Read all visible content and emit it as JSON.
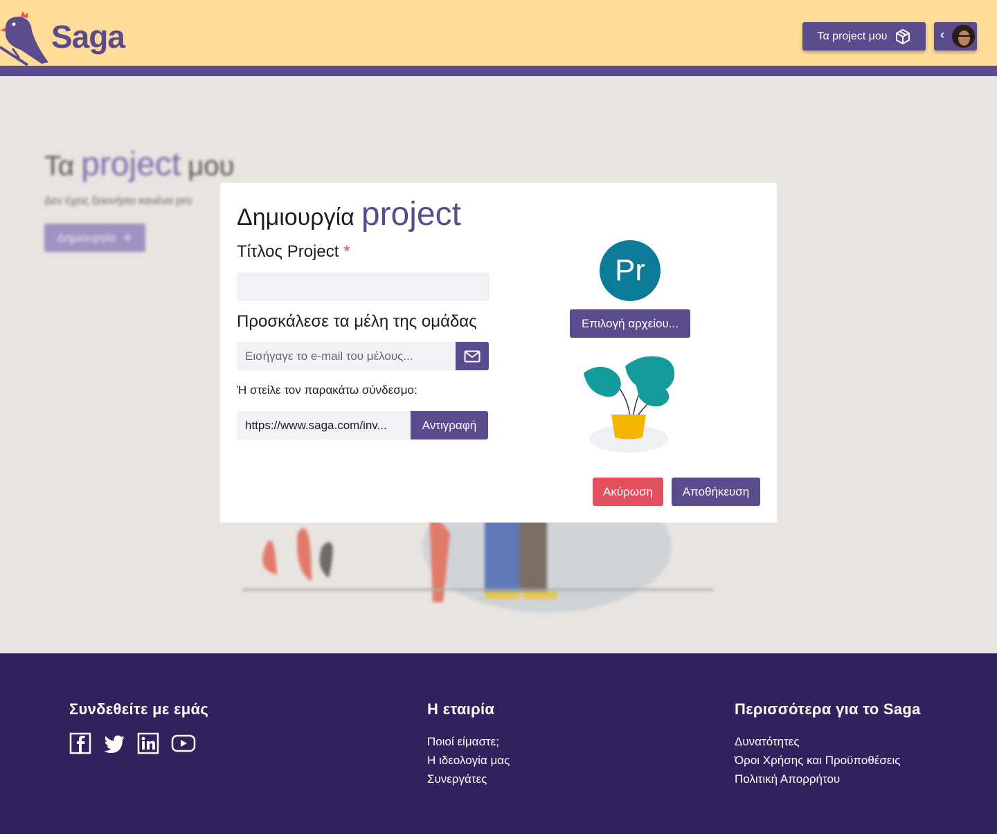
{
  "header": {
    "logo_text": "Saga",
    "projects_button": "Τα project μου"
  },
  "background": {
    "title_prefix": "Τα",
    "title_accent": "project",
    "title_suffix": "μου",
    "subtitle": "Δεν έχεις ξεκινήσει κανένα pro",
    "create_button": "Δημιουργία"
  },
  "dialog": {
    "title_prefix": "Δημιουργία",
    "title_accent": "project",
    "project_title_label": "Τίτλος Project",
    "required_mark": "*",
    "project_title_value": "",
    "invite_label": "Προσκάλεσε τα μέλη της ομάδας",
    "email_placeholder": "Εισήγαγε το e-mail του μέλους...",
    "link_label": "Ή στείλε τον παρακάτω σύνδεσμο:",
    "link_value": "https://www.saga.com/inv...",
    "copy_button": "Αντιγραφή",
    "avatar_initials": "Pr",
    "avatar_color": "#0b7b98",
    "file_button": "Επιλογή αρχείου...",
    "cancel_button": "Ακύρωση",
    "save_button": "Αποθήκευση"
  },
  "footer": {
    "connect": {
      "heading": "Συνδεθείτε με εμάς",
      "icons": [
        "facebook-icon",
        "twitter-icon",
        "linkedin-icon",
        "youtube-icon"
      ]
    },
    "company": {
      "heading": "Η εταιρία",
      "links": [
        "Ποιοί είμαστε;",
        "Η ιδεολογία μας",
        "Συνεργάτες"
      ]
    },
    "more": {
      "heading": "Περισσότερα για το Saga",
      "links": [
        "Δυνατότητες",
        "Όροι Χρήσης και Προϋποθέσεις",
        "Πολιτική Απορρήτου"
      ]
    }
  },
  "colors": {
    "brand": "#5a4b8c",
    "header_bg": "#ffdc98",
    "footer_bg": "#31225e",
    "danger": "#e0505e"
  }
}
